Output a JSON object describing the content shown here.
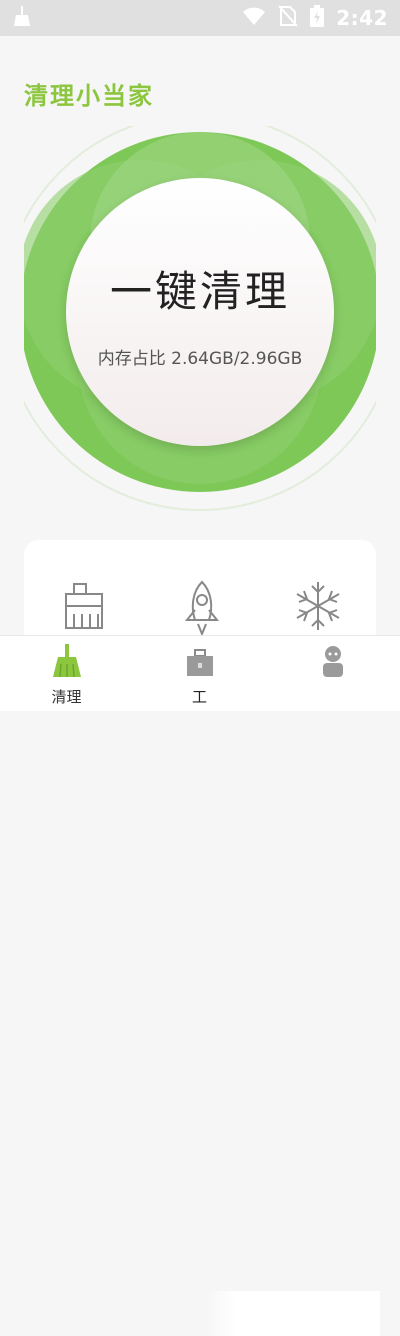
{
  "status_bar": {
    "time": "2:42",
    "icons": [
      "broom-notification-icon",
      "wifi-icon",
      "no-sim-icon",
      "battery-charging-icon"
    ]
  },
  "app": {
    "title": "清理小当家"
  },
  "cleaner": {
    "button_label": "一键清理",
    "memory_label": "内存占比",
    "memory_value": "2.64GB/2.96GB",
    "colors": {
      "ring_dark": "#7ec857",
      "ring_light": "#a5d88b"
    }
  },
  "tools": {
    "items": [
      {
        "icon": "clean-brush-icon"
      },
      {
        "icon": "rocket-icon"
      },
      {
        "icon": "snowflake-icon"
      }
    ]
  },
  "bottom_nav": {
    "items": [
      {
        "label": "清理",
        "icon": "broom-icon",
        "active": true
      },
      {
        "label": "工",
        "icon": "toolbox-icon",
        "active": false
      },
      {
        "label": "",
        "icon": "robot-icon",
        "active": false
      }
    ]
  },
  "colors": {
    "accent": "#8cc63f",
    "background": "#f6f6f6"
  }
}
